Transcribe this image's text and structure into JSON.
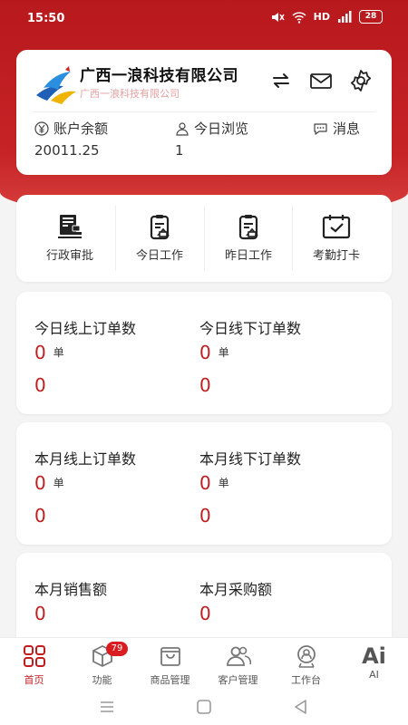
{
  "status_bar": {
    "time": "15:50",
    "network": "HD",
    "battery": "28"
  },
  "company": {
    "name": "广西一浪科技有限公司",
    "subtitle": "广西一浪科技有限公司",
    "icons": [
      "logo",
      "switch-icon",
      "mail-icon",
      "gear-icon"
    ]
  },
  "stats": {
    "balance": {
      "label": "账户余额",
      "value": "20011.25",
      "icon": "yen-icon"
    },
    "views": {
      "label": "今日浏览",
      "value": "1",
      "icon": "user-icon"
    },
    "messages": {
      "label": "消息",
      "icon": "chat-icon"
    }
  },
  "functions": [
    {
      "label": "行政审批",
      "icon": "approval-icon"
    },
    {
      "label": "今日工作",
      "icon": "clipboard-icon"
    },
    {
      "label": "昨日工作",
      "icon": "clipboard-icon"
    },
    {
      "label": "考勤打卡",
      "icon": "calendar-check-icon"
    }
  ],
  "orders_today": {
    "online": {
      "title": "今日线上订单数",
      "count": "0",
      "unit": "单",
      "amount": "0"
    },
    "offline": {
      "title": "今日线下订单数",
      "count": "0",
      "unit": "单",
      "amount": "0"
    }
  },
  "orders_month": {
    "online": {
      "title": "本月线上订单数",
      "count": "0",
      "unit": "单",
      "amount": "0"
    },
    "offline": {
      "title": "本月线下订单数",
      "count": "0",
      "unit": "单",
      "amount": "0"
    }
  },
  "monthly": {
    "sales": {
      "title": "本月销售额",
      "value": "0"
    },
    "purchase": {
      "title": "本月采购额",
      "value": "0"
    }
  },
  "tabbar": {
    "items": [
      {
        "label": "首页",
        "icon": "home-grid-icon",
        "active": true
      },
      {
        "label": "功能",
        "icon": "box-icon",
        "badge": "79"
      },
      {
        "label": "商品管理",
        "icon": "bag-icon"
      },
      {
        "label": "客户管理",
        "icon": "users-icon"
      },
      {
        "label": "工作台",
        "icon": "workbench-icon"
      },
      {
        "label": "AI",
        "icon": "ai-text-icon",
        "glyph": "Ai"
      }
    ]
  },
  "colors": {
    "brand": "#c11d1f",
    "hero": "#c62326"
  }
}
